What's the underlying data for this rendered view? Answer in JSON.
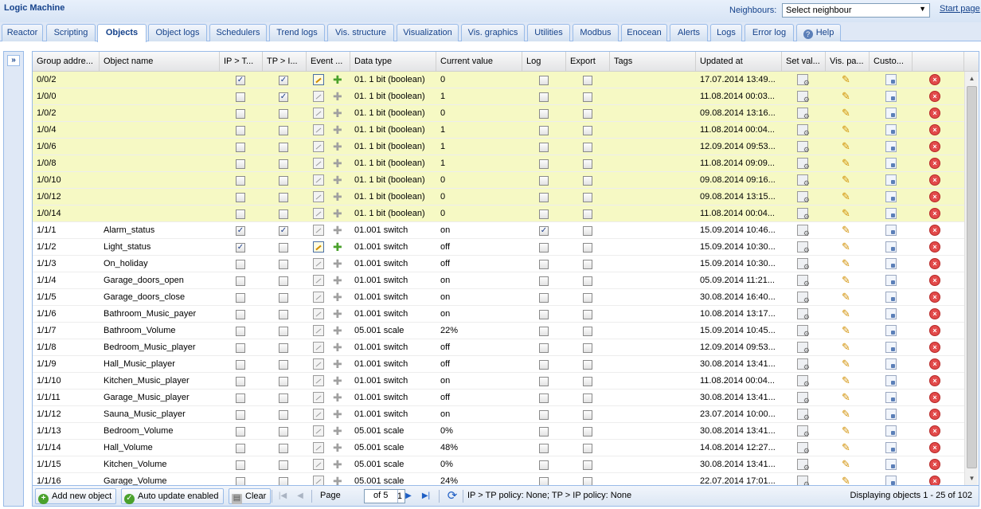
{
  "header": {
    "app_title": "Logic Machine",
    "neighbours_label": "Neighbours:",
    "neighbour_select": "Select neighbour",
    "start_page": "Start page"
  },
  "tabs": [
    "Reactor",
    "Scripting",
    "Objects",
    "Object logs",
    "Schedulers",
    "Trend logs",
    "Vis. structure",
    "Visualization",
    "Vis. graphics",
    "Utilities",
    "Modbus",
    "Enocean",
    "Alerts",
    "Logs",
    "Error log",
    "Help"
  ],
  "active_tab": "Objects",
  "columns": [
    "Group addre...",
    "Object name",
    "IP > T...",
    "TP > I...",
    "Event ...",
    "Data type",
    "Current value",
    "Log",
    "Export",
    "Tags",
    "Updated at",
    "Set val...",
    "Vis. pa...",
    "Custo..."
  ],
  "rows": [
    {
      "addr": "0/0/2",
      "name": "",
      "ip": true,
      "tp": true,
      "event": true,
      "type": "01. 1 bit (boolean)",
      "value": "0",
      "log": false,
      "updated": "17.07.2014 13:49...",
      "hl": true
    },
    {
      "addr": "1/0/0",
      "name": "",
      "ip": false,
      "tp": true,
      "event": false,
      "type": "01. 1 bit (boolean)",
      "value": "1",
      "log": false,
      "updated": "11.08.2014 00:03...",
      "hl": true
    },
    {
      "addr": "1/0/2",
      "name": "",
      "ip": false,
      "tp": false,
      "event": false,
      "type": "01. 1 bit (boolean)",
      "value": "0",
      "log": false,
      "updated": "09.08.2014 13:16...",
      "hl": true
    },
    {
      "addr": "1/0/4",
      "name": "",
      "ip": false,
      "tp": false,
      "event": false,
      "type": "01. 1 bit (boolean)",
      "value": "1",
      "log": false,
      "updated": "11.08.2014 00:04...",
      "hl": true
    },
    {
      "addr": "1/0/6",
      "name": "",
      "ip": false,
      "tp": false,
      "event": false,
      "type": "01. 1 bit (boolean)",
      "value": "1",
      "log": false,
      "updated": "12.09.2014 09:53...",
      "hl": true
    },
    {
      "addr": "1/0/8",
      "name": "",
      "ip": false,
      "tp": false,
      "event": false,
      "type": "01. 1 bit (boolean)",
      "value": "1",
      "log": false,
      "updated": "11.08.2014 09:09...",
      "hl": true
    },
    {
      "addr": "1/0/10",
      "name": "",
      "ip": false,
      "tp": false,
      "event": false,
      "type": "01. 1 bit (boolean)",
      "value": "0",
      "log": false,
      "updated": "09.08.2014 09:16...",
      "hl": true
    },
    {
      "addr": "1/0/12",
      "name": "",
      "ip": false,
      "tp": false,
      "event": false,
      "type": "01. 1 bit (boolean)",
      "value": "0",
      "log": false,
      "updated": "09.08.2014 13:15...",
      "hl": true
    },
    {
      "addr": "1/0/14",
      "name": "",
      "ip": false,
      "tp": false,
      "event": false,
      "type": "01. 1 bit (boolean)",
      "value": "0",
      "log": false,
      "updated": "11.08.2014 00:04...",
      "hl": true
    },
    {
      "addr": "1/1/1",
      "name": "Alarm_status",
      "ip": true,
      "tp": true,
      "event": false,
      "type": "01.001 switch",
      "value": "on",
      "log": true,
      "updated": "15.09.2014 10:46...",
      "hl": false
    },
    {
      "addr": "1/1/2",
      "name": "Light_status",
      "ip": true,
      "tp": false,
      "event": true,
      "type": "01.001 switch",
      "value": "off",
      "log": false,
      "updated": "15.09.2014 10:30...",
      "hl": false
    },
    {
      "addr": "1/1/3",
      "name": "On_holiday",
      "ip": false,
      "tp": false,
      "event": false,
      "type": "01.001 switch",
      "value": "off",
      "log": false,
      "updated": "15.09.2014 10:30...",
      "hl": false
    },
    {
      "addr": "1/1/4",
      "name": "Garage_doors_open",
      "ip": false,
      "tp": false,
      "event": false,
      "type": "01.001 switch",
      "value": "on",
      "log": false,
      "updated": "05.09.2014 11:21...",
      "hl": false
    },
    {
      "addr": "1/1/5",
      "name": "Garage_doors_close",
      "ip": false,
      "tp": false,
      "event": false,
      "type": "01.001 switch",
      "value": "on",
      "log": false,
      "updated": "30.08.2014 16:40...",
      "hl": false
    },
    {
      "addr": "1/1/6",
      "name": "Bathroom_Music_payer",
      "ip": false,
      "tp": false,
      "event": false,
      "type": "01.001 switch",
      "value": "on",
      "log": false,
      "updated": "10.08.2014 13:17...",
      "hl": false
    },
    {
      "addr": "1/1/7",
      "name": "Bathroom_Volume",
      "ip": false,
      "tp": false,
      "event": false,
      "type": "05.001 scale",
      "value": "22%",
      "log": false,
      "updated": "15.09.2014 10:45...",
      "hl": false
    },
    {
      "addr": "1/1/8",
      "name": "Bedroom_Music_player",
      "ip": false,
      "tp": false,
      "event": false,
      "type": "01.001 switch",
      "value": "off",
      "log": false,
      "updated": "12.09.2014 09:53...",
      "hl": false
    },
    {
      "addr": "1/1/9",
      "name": "Hall_Music_player",
      "ip": false,
      "tp": false,
      "event": false,
      "type": "01.001 switch",
      "value": "off",
      "log": false,
      "updated": "30.08.2014 13:41...",
      "hl": false
    },
    {
      "addr": "1/1/10",
      "name": "Kitchen_Music_player",
      "ip": false,
      "tp": false,
      "event": false,
      "type": "01.001 switch",
      "value": "on",
      "log": false,
      "updated": "11.08.2014 00:04...",
      "hl": false
    },
    {
      "addr": "1/1/11",
      "name": "Garage_Music_player",
      "ip": false,
      "tp": false,
      "event": false,
      "type": "01.001 switch",
      "value": "off",
      "log": false,
      "updated": "30.08.2014 13:41...",
      "hl": false
    },
    {
      "addr": "1/1/12",
      "name": "Sauna_Music_player",
      "ip": false,
      "tp": false,
      "event": false,
      "type": "01.001 switch",
      "value": "on",
      "log": false,
      "updated": "23.07.2014 10:00...",
      "hl": false
    },
    {
      "addr": "1/1/13",
      "name": "Bedroom_Volume",
      "ip": false,
      "tp": false,
      "event": false,
      "type": "05.001 scale",
      "value": "0%",
      "log": false,
      "updated": "30.08.2014 13:41...",
      "hl": false
    },
    {
      "addr": "1/1/14",
      "name": "Hall_Volume",
      "ip": false,
      "tp": false,
      "event": false,
      "type": "05.001 scale",
      "value": "48%",
      "log": false,
      "updated": "14.08.2014 12:27...",
      "hl": false
    },
    {
      "addr": "1/1/15",
      "name": "Kitchen_Volume",
      "ip": false,
      "tp": false,
      "event": false,
      "type": "05.001 scale",
      "value": "0%",
      "log": false,
      "updated": "30.08.2014 13:41...",
      "hl": false
    },
    {
      "addr": "1/1/16",
      "name": "Garage_Volume",
      "ip": false,
      "tp": false,
      "event": false,
      "type": "05.001 scale",
      "value": "24%",
      "log": false,
      "updated": "22.07.2014 17:01...",
      "hl": false
    }
  ],
  "toolbar": {
    "add_label": "Add new object",
    "auto_label": "Auto update enabled",
    "clear_label": "Clear",
    "page_label": "Page",
    "page_value": "1",
    "of_label": "of 5",
    "policy": "IP > TP policy: None; TP > IP policy: None",
    "displaying": "Displaying objects 1 - 25 of 102"
  },
  "icons": {
    "expand": "double-chevron-right-icon",
    "help": "help-icon",
    "log_chart": "chart-icon",
    "event_script": "puzzle-icon",
    "set_value": "settings-icon",
    "vis_params": "pencil-icon",
    "custom": "document-icon",
    "delete": "delete-icon",
    "add": "add-icon",
    "auto_update": "check-icon",
    "clear": "clear-icon",
    "first": "first-page-icon",
    "prev": "prev-page-icon",
    "next": "next-page-icon",
    "last": "last-page-icon",
    "refresh": "refresh-icon"
  },
  "colors": {
    "highlight_row": "#f6f9c4",
    "header_text": "#15428b",
    "delete": "#e24a4a",
    "event_active": "#4aa12c"
  }
}
